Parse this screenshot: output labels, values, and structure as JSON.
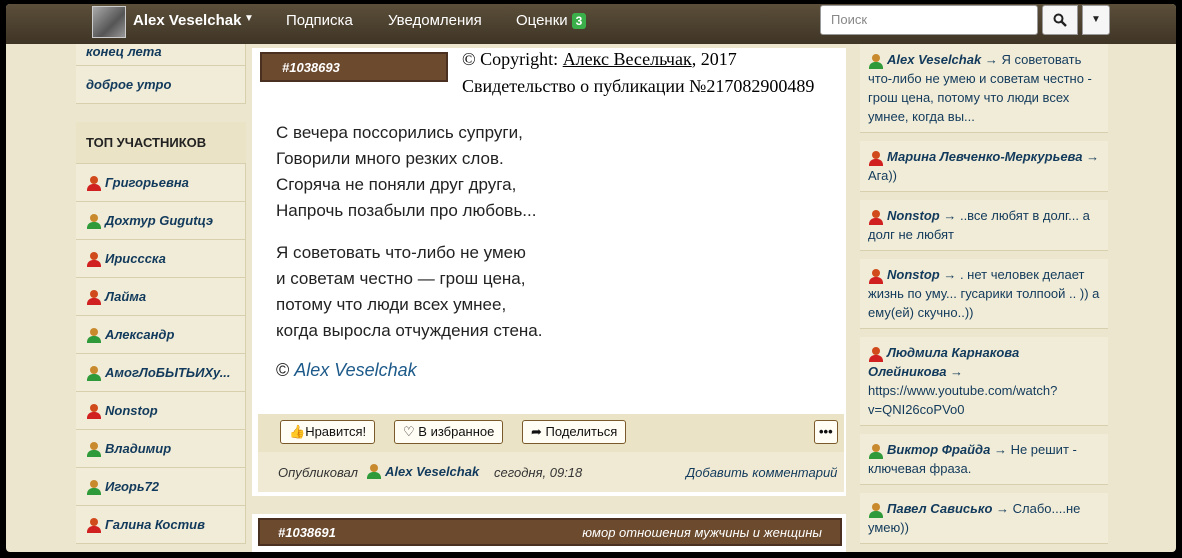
{
  "nav": {
    "user_name": "Alex Veselchak",
    "subscriptions": "Подписка",
    "notifications": "Уведомления",
    "ratings": "Оценки",
    "ratings_badge": "3",
    "search_placeholder": "Поиск"
  },
  "left": {
    "cards": [
      "конец лета",
      "доброе утро"
    ],
    "top_header": "ТОП УЧАСТНИКОВ",
    "members": [
      {
        "name": "Григорьевна",
        "gender": "f"
      },
      {
        "name": "Дохтур Gugutцэ",
        "gender": "m"
      },
      {
        "name": "Ирисcска",
        "gender": "f"
      },
      {
        "name": "Лайма",
        "gender": "f"
      },
      {
        "name": "Александр",
        "gender": "m"
      },
      {
        "name": "АмогЛоБЫТЬИХу...",
        "gender": "m"
      },
      {
        "name": "Nonstop",
        "gender": "f"
      },
      {
        "name": "Владимир",
        "gender": "m"
      },
      {
        "name": "Игорь72",
        "gender": "m"
      },
      {
        "name": "Галина Костив",
        "gender": "f"
      }
    ]
  },
  "post": {
    "id": "#1038693",
    "copyright_prefix": "© Copyright: ",
    "copyright_author": "Алекс Весельчак",
    "copyright_year": ", 2017",
    "certificate": "Свидетельство о публикации №217082900489",
    "stanza1": [
      "С вечера поссорились супруги,",
      "Говорили много резких слов.",
      "Сгоряча не поняли друг друга,",
      "Напрочь позабыли про любовь..."
    ],
    "stanza2": [
      "Я советовать что-либо не умею",
      "и советам честно — грош цена,",
      "потому что люди всех умнее,",
      "когда выросла отчуждения стена."
    ],
    "signature_mark": "©",
    "signature_name": "Alex Veselchak",
    "like_label": "Нравится!",
    "favorite_label": "В избранное",
    "share_label": "Поделиться",
    "more_label": "•••",
    "published_label": "Опубликовал",
    "author": "Alex Veselchak",
    "time": "сегодня, 09:18",
    "add_comment": "Добавить комментарий"
  },
  "post2": {
    "id": "#1038691",
    "tags": "юмор  отношения мужчины и женщины"
  },
  "right": {
    "items": [
      {
        "name": "Alex Veselchak",
        "gender": "m",
        "text": "Я советовать что-либо не умею и советам честно - грош цена, потому что люди всех умнее, когда вы..."
      },
      {
        "name": "Марина Левченко-Меркурьева",
        "gender": "f",
        "text": "Ага))"
      },
      {
        "name": "Nonstop",
        "gender": "f",
        "text": "..все любят в долг... а долг не любят"
      },
      {
        "name": "Nonstop",
        "gender": "f",
        "text": ". нет человек делает жизнь по уму... гусарики толпоой .. )) а ему(ей) скучно..))"
      },
      {
        "name": "Людмила Карнакова Олейникова",
        "gender": "f",
        "text": "https://www.youtube.com/watch?v=QNI26coPVo0"
      },
      {
        "name": "Виктор Фрайда",
        "gender": "m",
        "text": "Не решит - ключевая фраза."
      },
      {
        "name": "Павел Сависько",
        "gender": "m",
        "text": "Слабо....не умею))"
      }
    ]
  }
}
